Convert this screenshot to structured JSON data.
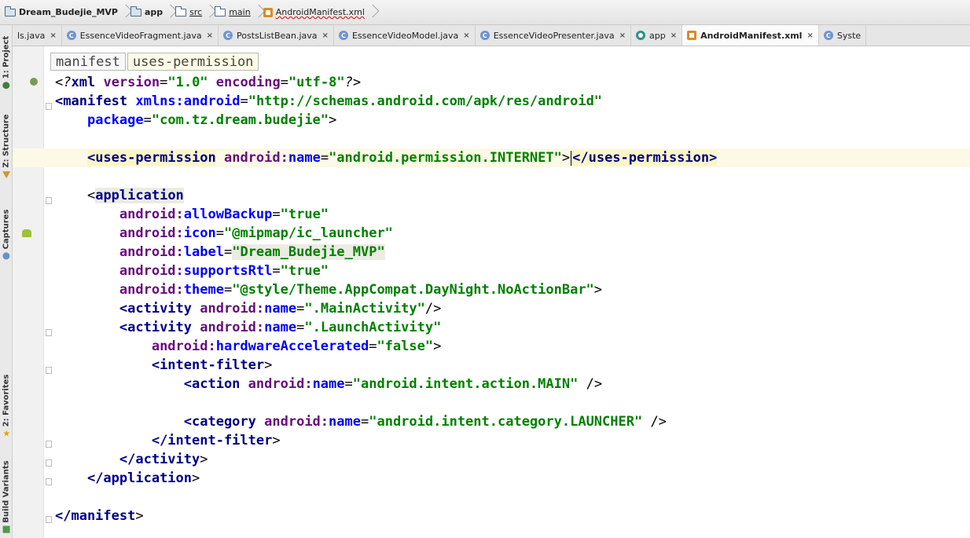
{
  "breadcrumb": {
    "project": "Dream_Budejie_MVP",
    "module": "app",
    "src": "src",
    "main": "main",
    "file": "AndroidManifest.xml"
  },
  "toolwindows": {
    "project": "1: Project",
    "structure": "Z: Structure",
    "captures": "Captures",
    "favorites": "2: Favorites",
    "build_variants": "Build Variants"
  },
  "tabs": [
    {
      "label": "ls.java",
      "icon": "none",
      "active": false
    },
    {
      "label": "EssenceVideoFragment.java",
      "icon": "class",
      "active": false
    },
    {
      "label": "PostsListBean.java",
      "icon": "class",
      "active": false
    },
    {
      "label": "EssenceVideoModel.java",
      "icon": "class",
      "active": false
    },
    {
      "label": "EssenceVideoPresenter.java",
      "icon": "class",
      "active": false
    },
    {
      "label": "app",
      "icon": "module",
      "active": false
    },
    {
      "label": "AndroidManifest.xml",
      "icon": "xml",
      "active": true
    },
    {
      "label": "Syste",
      "icon": "class",
      "active": false
    }
  ],
  "tab_close": "×",
  "class_badge": "C",
  "xml_path": [
    "manifest",
    "uses-permission"
  ],
  "code": {
    "l1": {
      "open": "<?",
      "tag": "xml",
      "a1": "version",
      "v1": "\"1.0\"",
      "a2": "encoding",
      "v2": "\"utf-8\"",
      "close": "?>"
    },
    "l2": {
      "tag": "<manifest",
      "ns": "xmlns:",
      "attr": "android",
      "val": "\"http://schemas.android.com/apk/res/android\""
    },
    "l3": {
      "attr": "package",
      "val": "\"com.tz.dream.budejie\"",
      "close": ">"
    },
    "l5": {
      "tag": "<uses-permission",
      "ns": "android:",
      "attr": "name",
      "val": "\"android.permission.INTERNET\"",
      "gt": ">",
      "endtag": "</uses-permission>"
    },
    "l7": {
      "lt": "<",
      "tag": "application"
    },
    "l8": {
      "ns": "android:",
      "attr": "allowBackup",
      "val": "\"true\""
    },
    "l9": {
      "ns": "android:",
      "attr": "icon",
      "val": "\"@mipmap/ic_launcher\""
    },
    "l10": {
      "ns": "android:",
      "attr": "label",
      "val": "\"Dream_Budejie_MVP\""
    },
    "l11": {
      "ns": "android:",
      "attr": "supportsRtl",
      "val": "\"true\""
    },
    "l12": {
      "ns": "android:",
      "attr": "theme",
      "val": "\"@style/Theme.AppCompat.DayNight.NoActionBar\"",
      "close": ">"
    },
    "l13": {
      "tag": "<activity",
      "ns": "android:",
      "attr": "name",
      "val": "\".MainActivity\"",
      "close": "/>"
    },
    "l14": {
      "tag": "<activity",
      "ns": "android:",
      "attr": "name",
      "val": "\".LaunchActivity\""
    },
    "l15": {
      "ns": "android:",
      "attr": "hardwareAccelerated",
      "val": "\"false\"",
      "close": ">"
    },
    "l16": {
      "tag": "<intent-filter",
      "close": ">"
    },
    "l17": {
      "tag": "<action",
      "ns": "android:",
      "attr": "name",
      "val": "\"android.intent.action.MAIN\"",
      "close": " />"
    },
    "l19": {
      "tag": "<category",
      "ns": "android:",
      "attr": "name",
      "val": "\"android.intent.category.LAUNCHER\"",
      "close": " />"
    },
    "l20": {
      "tag": "</intent-filter",
      "close": ">"
    },
    "l21": {
      "tag": "</activity",
      "close": ">"
    },
    "l22": {
      "tag": "</application",
      "close": ">"
    },
    "l24": {
      "tag": "</manifest",
      "close": ">"
    }
  }
}
